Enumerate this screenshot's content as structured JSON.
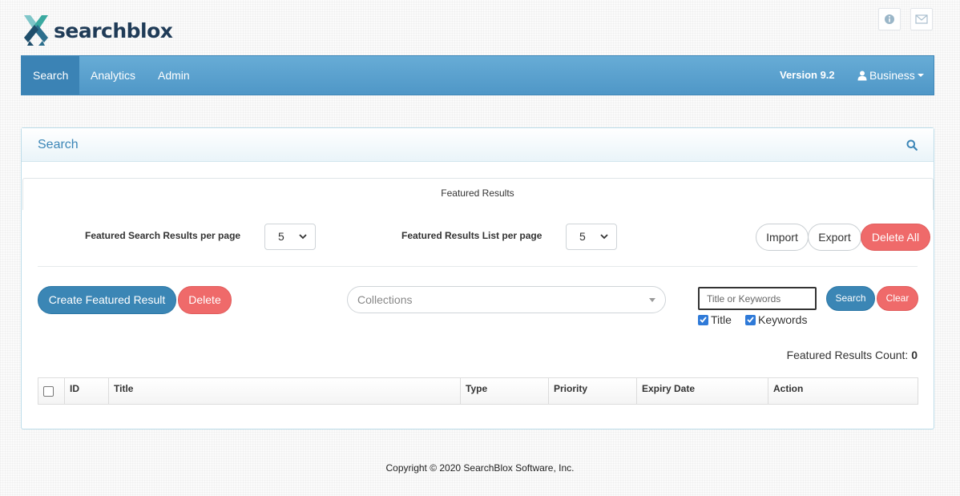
{
  "brand": {
    "name": "searchblox"
  },
  "header_icons": [
    "info-icon",
    "envelope-icon"
  ],
  "nav": {
    "items": [
      {
        "label": "Search",
        "active": true
      },
      {
        "label": "Analytics",
        "active": false
      },
      {
        "label": "Admin",
        "active": false
      }
    ],
    "version": "Version 9.2",
    "user": "Business"
  },
  "panel": {
    "title": "Search",
    "subtitle": "Featured Results",
    "per_page_label": "Featured Search Results per page",
    "per_page_value": "5",
    "list_per_page_label": "Featured Results List per page",
    "list_per_page_value": "5",
    "import_label": "Import",
    "export_label": "Export",
    "delete_all_label": "Delete All",
    "create_label": "Create Featured Result",
    "delete_label": "Delete",
    "collections_placeholder": "Collections",
    "keyword_placeholder": "Title or Keywords",
    "search_label": "Search",
    "clear_label": "Clear",
    "filter_title_label": "Title",
    "filter_title_checked": true,
    "filter_keywords_label": "Keywords",
    "filter_keywords_checked": true,
    "count_label": "Featured Results Count:",
    "count_value": "0"
  },
  "table": {
    "columns": [
      "ID",
      "Title",
      "Type",
      "Priority",
      "Expiry Date",
      "Action"
    ]
  },
  "footer": {
    "copyright": "Copyright © 2020 SearchBlox Software, Inc."
  },
  "colors": {
    "nav_bg": "#5aa2d0",
    "accent_blue": "#3b86b5",
    "danger_red": "#ef6a6a",
    "brand_dark": "#1f3b57"
  }
}
